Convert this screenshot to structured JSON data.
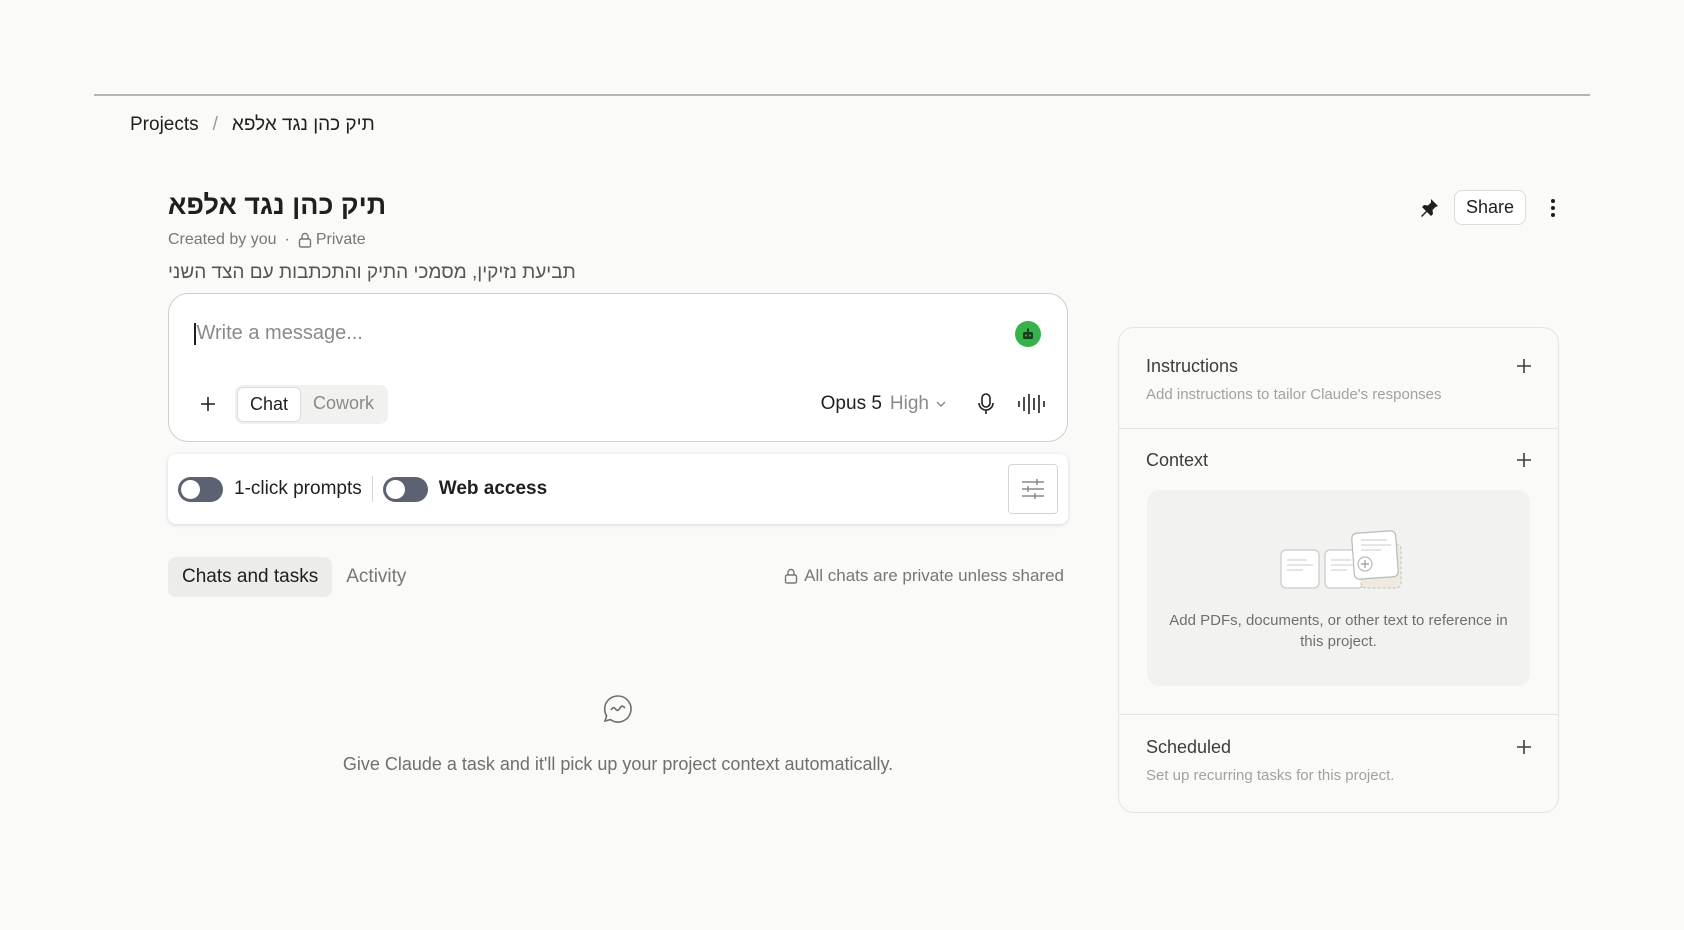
{
  "breadcrumb": {
    "root": "Projects",
    "separator": "/",
    "current": "תיק כהן נגד אלפא"
  },
  "project": {
    "title": "תיק כהן נגד אלפא",
    "created_by": "Created by you",
    "meta_separator": "·",
    "visibility": "Private",
    "description": "תביעת נזיקין, מסמכי התיק והתכתבות עם הצד השני"
  },
  "header_actions": {
    "pin_icon": "pin-icon",
    "share_label": "Share",
    "more_icon": "more-vertical-icon"
  },
  "composer": {
    "placeholder": "Write a message...",
    "modes": [
      "Chat",
      "Cowork"
    ],
    "active_mode": "Chat",
    "model": "Opus 5",
    "effort": "High",
    "extension_color": "#36b24a"
  },
  "tools": {
    "prompts_label": "1-click prompts",
    "prompts_enabled": false,
    "web_label": "Web access",
    "web_enabled": false
  },
  "tabs": {
    "items": [
      "Chats and tasks",
      "Activity"
    ],
    "active": "Chats and tasks",
    "privacy_note": "All chats are private unless shared"
  },
  "empty_state": {
    "text": "Give Claude a task and it'll pick up your project context automatically."
  },
  "sidebar": {
    "instructions": {
      "title": "Instructions",
      "subtitle": "Add instructions to tailor Claude's responses"
    },
    "context": {
      "title": "Context",
      "empty_text": "Add PDFs, documents, or other text to reference in this project."
    },
    "scheduled": {
      "title": "Scheduled",
      "subtitle": "Set up recurring tasks for this project."
    }
  }
}
